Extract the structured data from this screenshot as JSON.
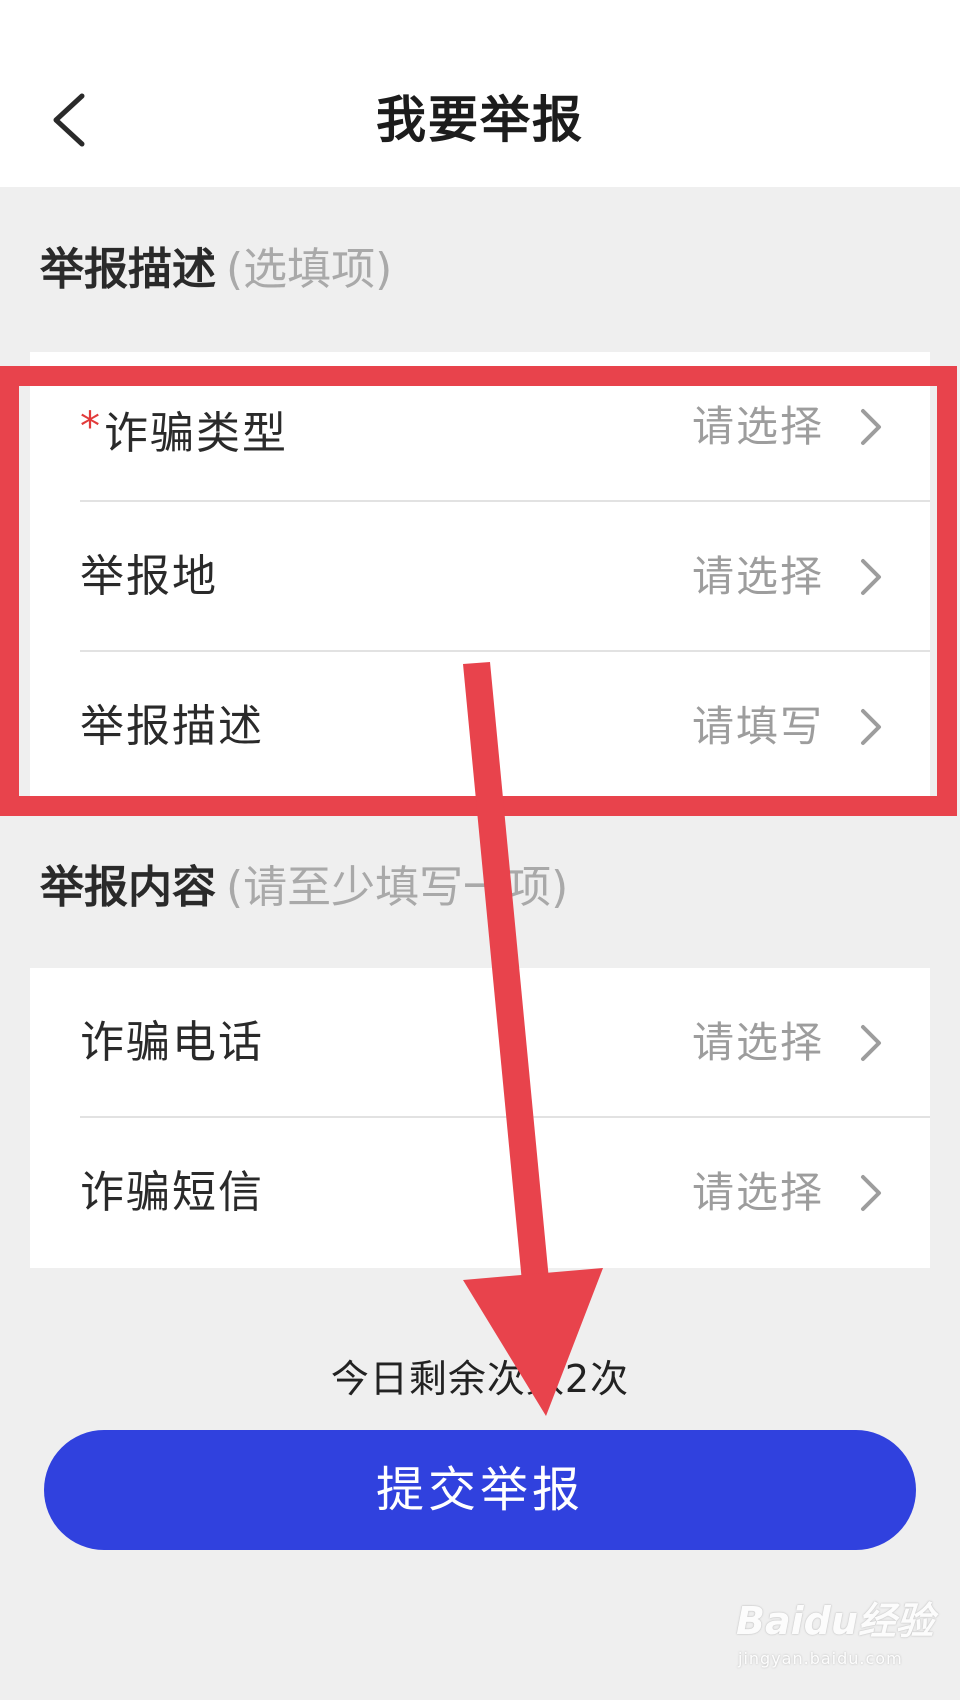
{
  "header": {
    "title": "我要举报",
    "back_icon": "chevron-left-icon"
  },
  "sections": {
    "description": {
      "title": "举报描述",
      "hint": "(选填项)",
      "rows": [
        {
          "required_mark": "*",
          "label": "诈骗类型",
          "value": "请选择"
        },
        {
          "label": "举报地",
          "value": "请选择"
        },
        {
          "label": "举报描述",
          "value": "请填写"
        }
      ]
    },
    "content": {
      "title": "举报内容",
      "hint": "(请至少填写一项)",
      "rows": [
        {
          "label": "诈骗电话",
          "value": "请选择"
        },
        {
          "label": "诈骗短信",
          "value": "请选择"
        }
      ]
    }
  },
  "footer": {
    "remaining": "今日剩余次数2次",
    "submit_label": "提交举报"
  },
  "watermark": {
    "logo": "Baidu经验",
    "url": "jingyan.baidu.com"
  },
  "colors": {
    "accent": "#3041de",
    "required": "#e23b3b",
    "annotation": "#e8434c"
  }
}
